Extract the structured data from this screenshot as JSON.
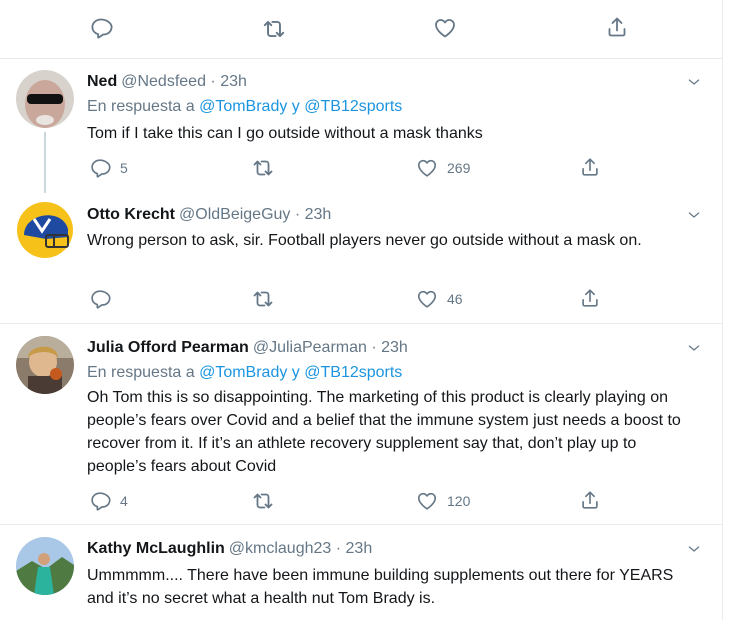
{
  "tweets": [
    {
      "name": "Ned",
      "handle": "@Nedsfeed",
      "time": "· 23h",
      "reply_prefix": "En respuesta a",
      "reply_m1": "@TomBrady",
      "reply_joiner": "y",
      "reply_m2": "@TB12sports",
      "text": "Tom if I take this can I go outside without a mask thanks",
      "replies": "5",
      "likes": "269"
    },
    {
      "name": "Otto Krecht",
      "handle": "@OldBeigeGuy",
      "time": "· 23h",
      "text": "Wrong person to ask, sir. Football players never go outside without a mask on.",
      "likes": "46"
    },
    {
      "name": "Julia Offord Pearman",
      "handle": "@JuliaPearman",
      "time": "· 23h",
      "reply_prefix": "En respuesta a",
      "reply_m1": "@TomBrady",
      "reply_joiner": "y",
      "reply_m2": "@TB12sports",
      "text": "Oh Tom this is so disappointing. The marketing of this product is clearly playing on people’s fears over Covid and a belief that the immune system just needs a boost to recover from it. If it’s an athlete recovery supplement say that, don’t play up to people’s fears about Covid",
      "replies": "4",
      "likes": "120"
    },
    {
      "name": "Kathy McLaughlin",
      "handle": "@kmclaugh23",
      "time": "· 23h",
      "text": "Ummmmm.... There have been immune building supplements out there for YEARS and it’s no secret what a health nut Tom Brady is."
    }
  ],
  "icons": {
    "reply": "reply-icon",
    "retweet": "retweet-icon",
    "like": "like-icon",
    "share": "share-icon",
    "caret": "chevron-down-icon"
  },
  "colors": {
    "mention": "#1b95e0",
    "secondary": "#657786",
    "divider": "#e6ecf0"
  }
}
